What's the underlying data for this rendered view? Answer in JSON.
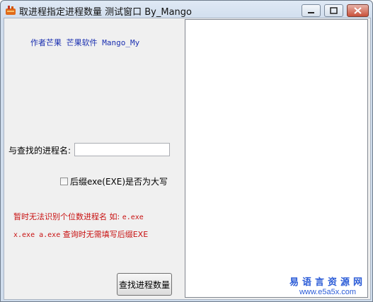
{
  "window": {
    "title": "取进程指定进程数量 测试窗口  By_Mango",
    "icon": "app-icon"
  },
  "author_line": "作者芒果 芒果软件 Mango_My",
  "process_name": {
    "label": "与查找的进程名:",
    "value": ""
  },
  "checkbox": {
    "label": "后缀exe(EXE)是否为大写",
    "checked": false
  },
  "warning": {
    "line1_cn": "暂时无法识别个位数进程名 如:",
    "line1_code": "e.exe",
    "line2_code": "x.exe a.exe",
    "line2_cn": "查询时无需填写后缀EXE"
  },
  "buttons": {
    "find": "查找进程数量"
  },
  "watermark": {
    "name": "易语言资源网",
    "url": "www.e5a5x.com"
  },
  "colors": {
    "author_text": "#1a2fb0",
    "warning_text": "#c81010",
    "watermark": "#2a5bd7"
  }
}
